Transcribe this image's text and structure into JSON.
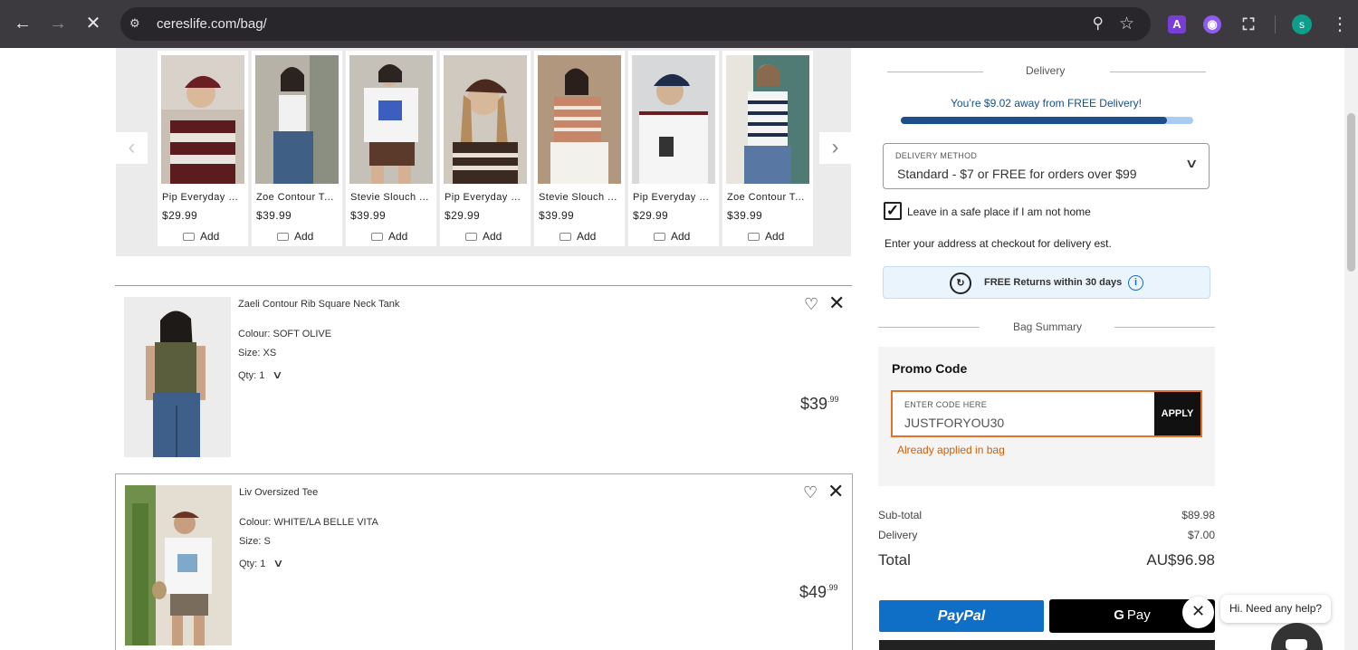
{
  "browser": {
    "url": "cereslife.com/bag/",
    "profile_initial": "s",
    "ext_a_label": "A"
  },
  "carousel": {
    "products": [
      {
        "name": "Pip Everyday Cap Rugby",
        "price": "$29.99",
        "add_label": "Add"
      },
      {
        "name": "Zoe Contour Tank",
        "price": "$39.99",
        "add_label": "Add"
      },
      {
        "name": "Stevie Slouch Tee",
        "price": "$39.99",
        "add_label": "Add"
      },
      {
        "name": "Pip Everyday Cap",
        "price": "$29.99",
        "add_label": "Add"
      },
      {
        "name": "Stevie Slouch Tee",
        "price": "$39.99",
        "add_label": "Add"
      },
      {
        "name": "Pip Everyday Cap",
        "price": "$29.99",
        "add_label": "Add"
      },
      {
        "name": "Zoe Contour Tank",
        "price": "$39.99",
        "add_label": "Add"
      }
    ]
  },
  "bag_items": [
    {
      "name": "Zaeli Contour Rib Square Neck Tank",
      "colour": "Colour: SOFT OLIVE",
      "size": "Size: XS",
      "qty": "Qty: 1",
      "price_main": "$39",
      "price_cents": ".99"
    },
    {
      "name": "Liv Oversized Tee",
      "colour": "Colour: WHITE/LA BELLE VITA",
      "size": "Size: S",
      "qty": "Qty: 1",
      "price_main": "$49",
      "price_cents": ".99"
    }
  ],
  "delivery": {
    "heading": "Delivery",
    "free_message": "You’re $9.02 away from FREE Delivery!",
    "progress": 0.91,
    "method_label": "DELIVERY METHOD",
    "method_value": "Standard - $7 or FREE for orders over $99",
    "safe_place_label": "Leave in a safe place if I am not home",
    "safe_place_checked": true,
    "address_note": "Enter your address at checkout for delivery est.",
    "returns_text": "FREE Returns within 30 days"
  },
  "summary": {
    "heading": "Bag Summary",
    "promo_title": "Promo Code",
    "promo_label": "ENTER CODE HERE",
    "promo_value": "JUSTFORYOU30",
    "apply_label": "APPLY",
    "promo_error": "Already applied in bag",
    "subtotal_label": "Sub-total",
    "subtotal_value": "$89.98",
    "delivery_label": "Delivery",
    "delivery_value": "$7.00",
    "total_label": "Total",
    "total_value": "AU$96.98"
  },
  "payments": {
    "paypal_label": "PayPal",
    "gpay_label": "Pay",
    "gpay_g": "G"
  },
  "chat": {
    "bubble_text": "Hi. Need any help?"
  },
  "colors": {
    "accent_blue": "#1c4f8c",
    "promo_border": "#e2712a",
    "paypal_blue": "#0f6ec5"
  }
}
